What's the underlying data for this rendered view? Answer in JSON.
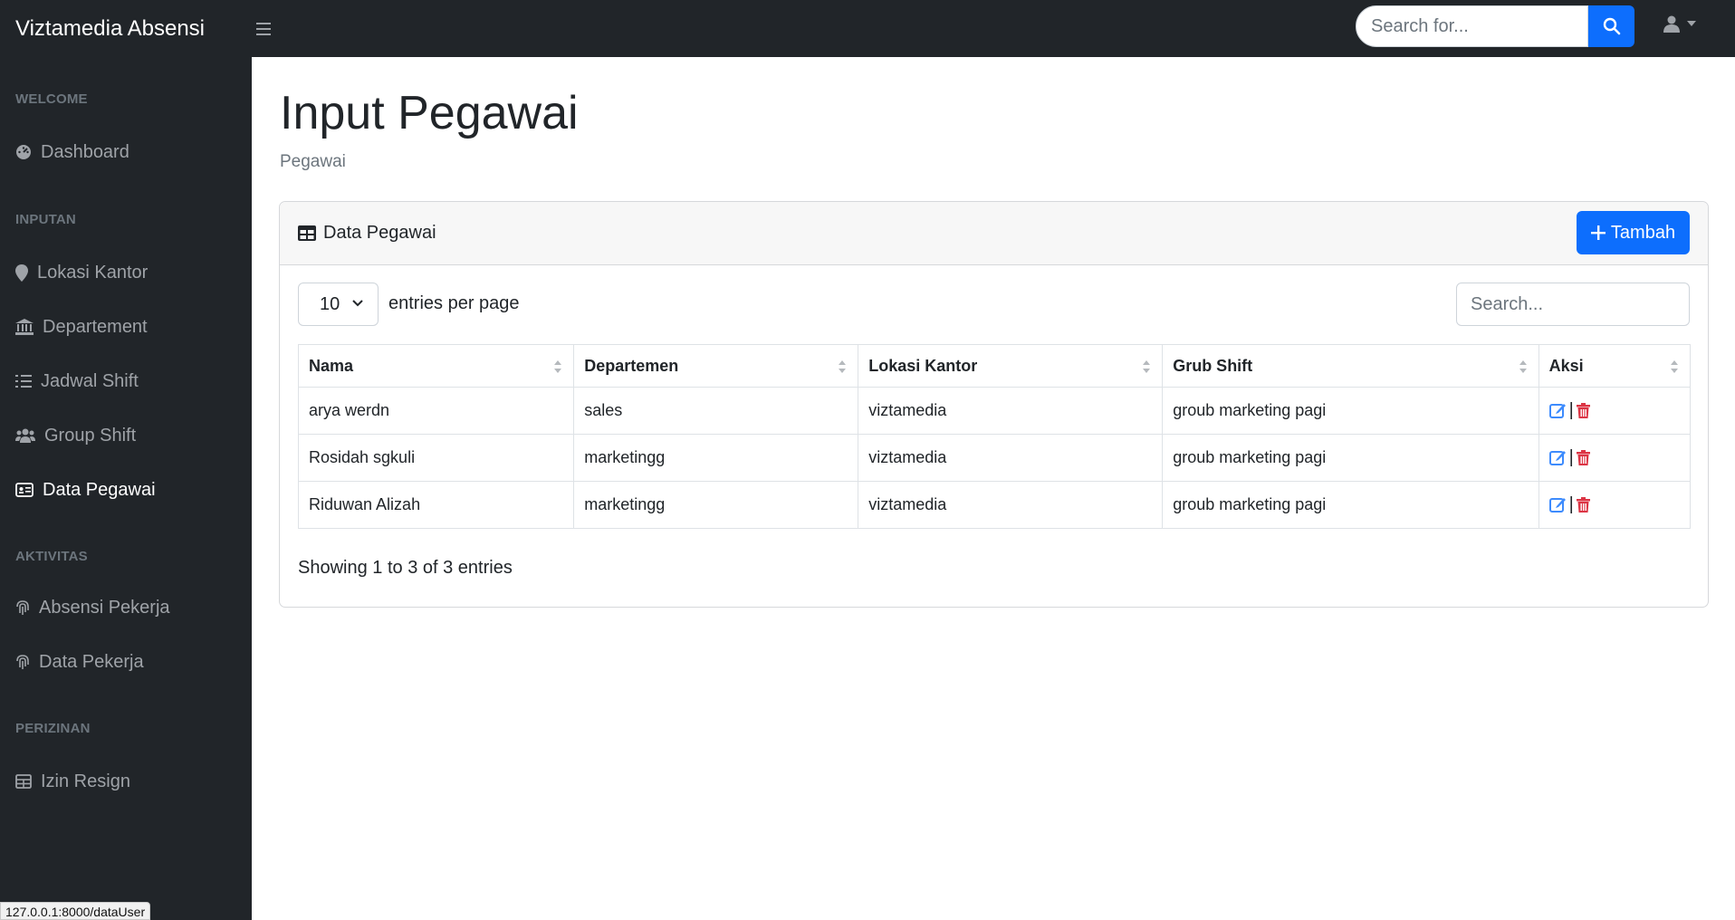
{
  "app": {
    "brand": "Viztamedia Absensi"
  },
  "topnav": {
    "search_placeholder": "Search for..."
  },
  "sidebar": {
    "sections": [
      {
        "heading": "WELCOME",
        "items": [
          {
            "label": "Dashboard",
            "icon": "dashboard-icon"
          }
        ]
      },
      {
        "heading": "INPUTAN",
        "items": [
          {
            "label": "Lokasi Kantor",
            "icon": "map-marker-icon"
          },
          {
            "label": "Departement",
            "icon": "bank-icon"
          },
          {
            "label": "Jadwal Shift",
            "icon": "list-ol-icon"
          },
          {
            "label": "Group Shift",
            "icon": "users-icon"
          },
          {
            "label": "Data Pegawai",
            "icon": "id-card-icon",
            "active": true
          }
        ]
      },
      {
        "heading": "AKTIVITAS",
        "items": [
          {
            "label": "Absensi Pekerja",
            "icon": "fingerprint-icon"
          },
          {
            "label": "Data Pekerja",
            "icon": "fingerprint-icon"
          }
        ]
      },
      {
        "heading": "PERIZINAN",
        "items": [
          {
            "label": "Izin Resign",
            "icon": "table-icon"
          }
        ]
      }
    ]
  },
  "status_url": "127.0.0.1:8000/dataUser",
  "page": {
    "title": "Input Pegawai",
    "breadcrumb": "Pegawai"
  },
  "card": {
    "title": "Data Pegawai",
    "add_button": "Tambah",
    "entries_value": "10",
    "entries_label": "entries per page",
    "search_placeholder": "Search...",
    "columns": [
      "Nama",
      "Departemen",
      "Lokasi Kantor",
      "Grub Shift",
      "Aksi"
    ],
    "rows": [
      [
        "arya werdn",
        "sales",
        "viztamedia",
        "groub marketing pagi"
      ],
      [
        "Rosidah sgkuli",
        "marketingg",
        "viztamedia",
        "groub marketing pagi"
      ],
      [
        "Riduwan Alizah",
        "marketingg",
        "viztamedia",
        "groub marketing pagi"
      ]
    ],
    "aksi_separator": "|",
    "showing": "Showing 1 to 3 of 3 entries"
  },
  "colors": {
    "primary": "#0d6efd",
    "dark": "#212529",
    "danger": "#dc3545",
    "edit": "#3d8bfd"
  }
}
